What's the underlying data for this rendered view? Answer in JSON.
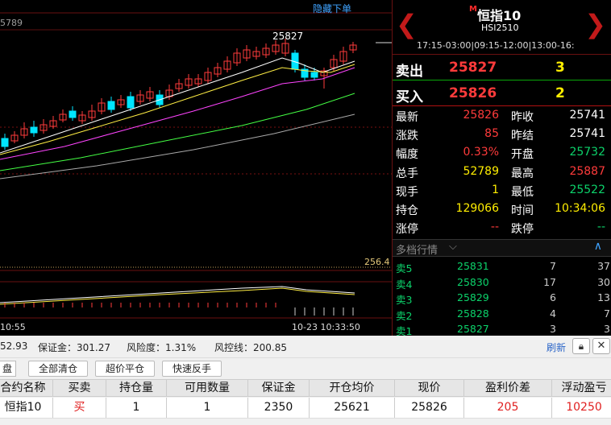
{
  "chart": {
    "hide_order_label": "隐藏下单",
    "high_label": "25827",
    "y_top_label": "5789",
    "ma_level_label": "256.4",
    "time_left": "10:55",
    "time_right": "10-23 10:33:50"
  },
  "colors": {
    "up": "#ff3b3b",
    "down": "#00e5ff",
    "ma5": "#ffffff",
    "ma10": "#ffee44",
    "ma20": "#ff44ff",
    "ma40": "#44ff44",
    "ma60": "#aaaaaa",
    "bid_ask_green": "#0cd36b"
  },
  "header": {
    "m_mark": "M",
    "symbol_name": "恒指10",
    "symbol_code": "HSI2510",
    "session_times": "17:15-03:00|09:15-12:00|13:00-16:"
  },
  "quote": {
    "sell_label": "卖出",
    "sell_price": "25827",
    "sell_vol": "3",
    "buy_label": "买入",
    "buy_price": "25826",
    "buy_vol": "2"
  },
  "stats": [
    {
      "k": "最新",
      "v": "25826",
      "vc": "#ff3b3b",
      "k2": "昨收",
      "v2": "25741",
      "v2c": "#ffffff"
    },
    {
      "k": "涨跌",
      "v": "85",
      "vc": "#ff3b3b",
      "k2": "昨结",
      "v2": "25741",
      "v2c": "#ffffff"
    },
    {
      "k": "幅度",
      "v": "0.33%",
      "vc": "#ff3b3b",
      "k2": "开盘",
      "v2": "25732",
      "v2c": "#0cd36b"
    },
    {
      "k": "总手",
      "v": "52789",
      "vc": "#ffee00",
      "k2": "最高",
      "v2": "25887",
      "v2c": "#ff3b3b"
    },
    {
      "k": "现手",
      "v": "1",
      "vc": "#ffee00",
      "k2": "最低",
      "v2": "25522",
      "v2c": "#0cd36b"
    },
    {
      "k": "持仓",
      "v": "129066",
      "vc": "#ffee00",
      "k2": "时间",
      "v2": "10:34:06",
      "v2c": "#ffee00"
    },
    {
      "k": "涨停",
      "v": "--",
      "vc": "#ff3b3b",
      "k2": "跌停",
      "v2": "--",
      "v2c": "#0cd36b"
    }
  ],
  "depth": {
    "title": "多档行情",
    "rows": [
      {
        "label": "卖5",
        "price": "25831",
        "vol": "7",
        "total": "37"
      },
      {
        "label": "卖4",
        "price": "25830",
        "vol": "17",
        "total": "30"
      },
      {
        "label": "卖3",
        "price": "25829",
        "vol": "6",
        "total": "13"
      },
      {
        "label": "卖2",
        "price": "25828",
        "vol": "4",
        "total": "7"
      },
      {
        "label": "卖1",
        "price": "25827",
        "vol": "3",
        "total": "3"
      }
    ]
  },
  "account": {
    "balance_partial": "52.93",
    "margin": "保证金：301.27",
    "risk": "风险度：1.31%",
    "risk_line": "风控线：200.85",
    "refresh": "刷新"
  },
  "buttons": {
    "tab_left": "盘",
    "close_all": "全部清仓",
    "exceed_price": "超价平仓",
    "quick_reverse": "快速反手"
  },
  "grid": {
    "headers": [
      "合约名称",
      "买卖",
      "持仓量",
      "可用数量",
      "保证金",
      "开仓均价",
      "现价",
      "盈利价差",
      "浮动盈亏"
    ],
    "row": [
      "恒指10",
      "买",
      "1",
      "1",
      "2350",
      "25621",
      "25826",
      "205",
      "10250"
    ]
  }
}
